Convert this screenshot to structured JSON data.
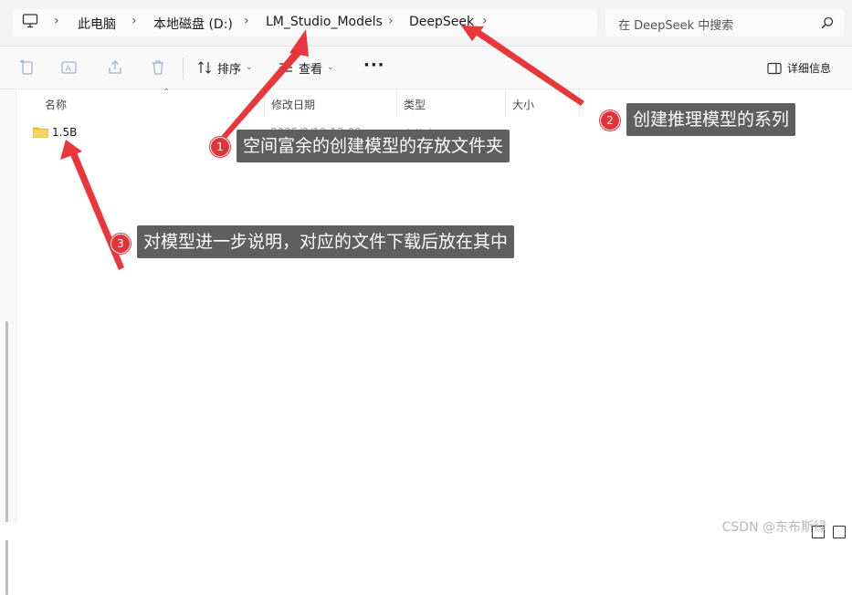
{
  "breadcrumb": {
    "items": [
      "此电脑",
      "本地磁盘 (D:)",
      "LM_Studio_Models",
      "DeepSeek"
    ],
    "icon": "computer-icon",
    "separator_icon": "chevron-right-icon"
  },
  "search": {
    "placeholder": "在 DeepSeek 中搜索",
    "icon": "search-icon"
  },
  "toolbar": {
    "copy_icon": "copy-icon",
    "rename_icon": "rename-icon",
    "share_icon": "share-icon",
    "delete_icon": "delete-icon",
    "sort_label": "排序",
    "view_label": "查看",
    "more_label": "···",
    "details_label": "详细信息"
  },
  "columns": [
    "名称",
    "修改日期",
    "类型",
    "大小"
  ],
  "files": [
    {
      "name": "1.5B",
      "modified": "2025/2/19 13:09",
      "type": "文件夹",
      "size": "",
      "icon": "folder-icon"
    }
  ],
  "annotations": [
    {
      "number": "1",
      "text": "空间富余的创建模型的存放文件夹"
    },
    {
      "number": "2",
      "text": "创建推理模型的系列"
    },
    {
      "number": "3",
      "text": "对模型进一步说明，对应的文件下载后放在其中"
    }
  ],
  "watermark": "CSDN @东布斯绿",
  "colors": {
    "annotation_bg": "#5f5f5f",
    "badge_red": "#e0343a",
    "arrow_red": "#e8363b",
    "folder_yellow": "#f4c542"
  }
}
